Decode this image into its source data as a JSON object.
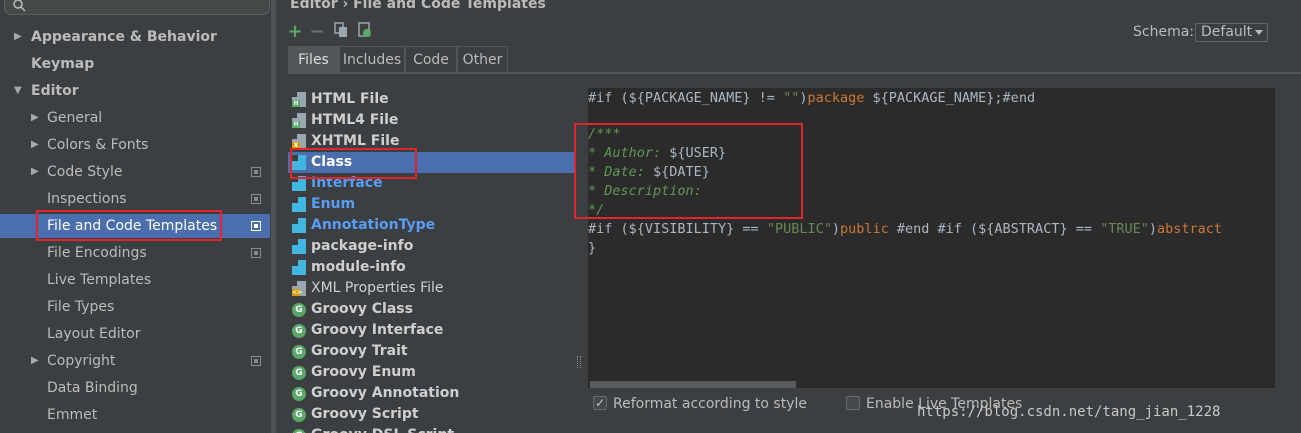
{
  "breadcrumb": "Editor › File and Code Templates",
  "schema": {
    "label": "Schema:",
    "value": "Default"
  },
  "tabs": [
    {
      "label": "Files"
    },
    {
      "label": "Includes"
    },
    {
      "label": "Code"
    },
    {
      "label": "Other"
    }
  ],
  "settings_tree": [
    {
      "label": "Appearance & Behavior"
    },
    {
      "label": "Keymap"
    },
    {
      "label": "Editor"
    },
    {
      "label": "General"
    },
    {
      "label": "Colors & Fonts"
    },
    {
      "label": "Code Style"
    },
    {
      "label": "Inspections"
    },
    {
      "label": "File and Code Templates"
    },
    {
      "label": "File Encodings"
    },
    {
      "label": "Live Templates"
    },
    {
      "label": "File Types"
    },
    {
      "label": "Layout Editor"
    },
    {
      "label": "Copyright"
    },
    {
      "label": "Data Binding"
    },
    {
      "label": "Emmet"
    }
  ],
  "templates": [
    {
      "name": "HTML File",
      "icon": "html-file-icon"
    },
    {
      "name": "HTML4 File",
      "icon": "html-file-icon"
    },
    {
      "name": "XHTML File",
      "icon": "xhtml-file-icon"
    },
    {
      "name": "Class",
      "icon": "java-class-icon"
    },
    {
      "name": "Interface",
      "icon": "java-interface-icon"
    },
    {
      "name": "Enum",
      "icon": "java-enum-icon"
    },
    {
      "name": "AnnotationType",
      "icon": "java-annotation-icon"
    },
    {
      "name": "package-info",
      "icon": "java-file-icon"
    },
    {
      "name": "module-info",
      "icon": "java-file-icon"
    },
    {
      "name": "XML Properties File",
      "icon": "xml-file-icon"
    },
    {
      "name": "Groovy Class",
      "icon": "groovy-icon"
    },
    {
      "name": "Groovy Interface",
      "icon": "groovy-icon"
    },
    {
      "name": "Groovy Trait",
      "icon": "groovy-icon"
    },
    {
      "name": "Groovy Enum",
      "icon": "groovy-icon"
    },
    {
      "name": "Groovy Annotation",
      "icon": "groovy-icon"
    },
    {
      "name": "Groovy Script",
      "icon": "groovy-icon"
    },
    {
      "name": "Groovy DSL Script",
      "icon": "groovy-icon"
    }
  ],
  "code": {
    "line1": {
      "a": "#if (${PACKAGE_NAME} != ",
      "b": "\"\"",
      "c": ")",
      "d": "package ",
      "e": "${PACKAGE_NAME};#end"
    },
    "comment": [
      "/***",
      "* Author: ",
      "* Date: ",
      "* Description:",
      "*/"
    ],
    "user_var": "${USER}",
    "date_var": "${DATE}",
    "line7": {
      "a": "#if (${VISIBILITY} == ",
      "b": "\"PUBLIC\"",
      "c": ")",
      "d": "public ",
      "e": "#end #if (${ABSTRACT} == ",
      "f": "\"TRUE\"",
      "g": ")",
      "h": "abstract"
    },
    "line8": "}"
  },
  "options": {
    "reformat": {
      "label": "Reformat according to style",
      "checked": true
    },
    "live_templates": {
      "label": "Enable Live Templates",
      "checked": false
    }
  },
  "watermark": "https://blog.csdn.net/tang_jian_1228",
  "colors": {
    "selection": "#4b6eaf",
    "highlight_box": "#e0262c",
    "keyword": "#cc7832",
    "string": "#6a8759",
    "comment": "#629755"
  }
}
